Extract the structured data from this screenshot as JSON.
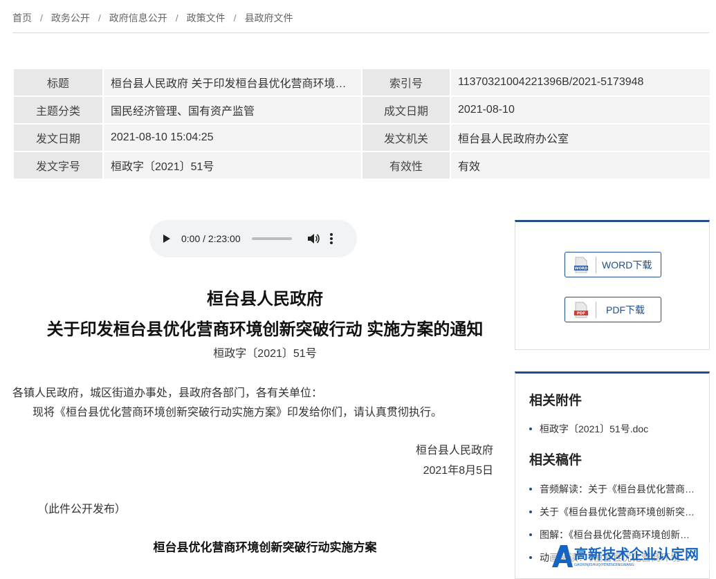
{
  "breadcrumb": [
    "首页",
    "政务公开",
    "政府信息公开",
    "政策文件",
    "县政府文件"
  ],
  "meta": {
    "rows": [
      [
        {
          "k": "标题",
          "v": "桓台县人民政府 关于印发桓台县优化营商环境创新突破行动 实施方案的通知"
        },
        {
          "k": "索引号",
          "v": "11370321004221396B/2021-5173948"
        }
      ],
      [
        {
          "k": "主题分类",
          "v": "国民经济管理、国有资产监管"
        },
        {
          "k": "成文日期",
          "v": "2021-08-10"
        }
      ],
      [
        {
          "k": "发文日期",
          "v": "2021-08-10 15:04:25"
        },
        {
          "k": "发文机关",
          "v": "桓台县人民政府办公室"
        }
      ],
      [
        {
          "k": "发文字号",
          "v": "桓政字〔2021〕51号"
        },
        {
          "k": "有效性",
          "v": "有效"
        }
      ]
    ]
  },
  "audio": {
    "time": "0:00 / 2:23:00",
    "progress": 0
  },
  "document": {
    "org": "桓台县人民政府",
    "title": "关于印发桓台县优化营商环境创新突破行动 实施方案的通知",
    "number": "桓政字〔2021〕51号",
    "recipients": "各镇人民政府，城区街道办事处，县政府各部门，各有关单位：",
    "body": "现将《桓台县优化营商环境创新突破行动实施方案》印发给你们，请认真贯彻执行。",
    "sign_org": "桓台县人民政府",
    "sign_date": "2021年8月5日",
    "public_note": "（此件公开发布）",
    "subtitle": "桓台县优化营商环境创新突破行动实施方案"
  },
  "downloads": {
    "word": {
      "label": "WORD下载",
      "icon_text": "WORD",
      "color": "#2b5797"
    },
    "pdf": {
      "label": "PDF下载",
      "icon_text": "PDF",
      "color": "#d9382c"
    }
  },
  "related": {
    "attachments_heading": "相关附件",
    "attachments": [
      "桓政字〔2021〕51号.doc"
    ],
    "articles_heading": "相关稿件",
    "articles": [
      "音频解读：关于《桓台县优化营商环境创新突破行动实施方案》的解读",
      "关于《桓台县优化营商环境创新突破行动实施方案》的政策解读",
      "图解：《桓台县优化营商环境创新突破行动实施方案》",
      "动画解读：《桓台县优化营商环境创新突破行动实施方案》"
    ]
  },
  "watermark": {
    "main": "高新技术企业认定网",
    "sub": "GAOXINJISHUQIYERENDINGWANG"
  },
  "colors": {
    "accent": "#1f4e8c",
    "watermark": "#1565c0"
  }
}
